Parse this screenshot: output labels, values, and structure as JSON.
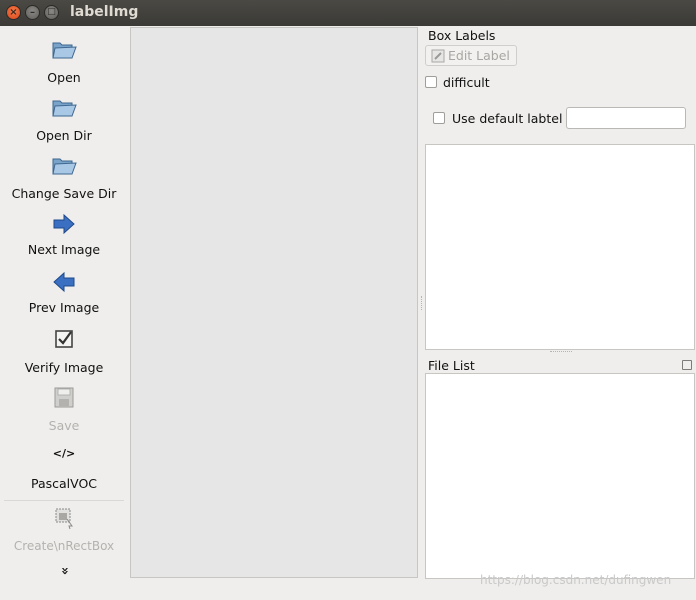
{
  "window": {
    "title": "labelImg",
    "controls": {
      "close": "×",
      "minimize": "–",
      "maximize": "□"
    }
  },
  "toolbar": {
    "items": [
      {
        "label": "Open",
        "icon": "folder-open-icon",
        "enabled": true
      },
      {
        "label": "Open Dir",
        "icon": "folder-open-icon",
        "enabled": true
      },
      {
        "label": "Change Save Dir",
        "icon": "folder-open-icon",
        "enabled": true
      },
      {
        "label": "Next Image",
        "icon": "arrow-right-icon",
        "enabled": true
      },
      {
        "label": "Prev Image",
        "icon": "arrow-left-icon",
        "enabled": true
      },
      {
        "label": "Verify Image",
        "icon": "checkbox-checked-icon",
        "enabled": true
      },
      {
        "label": "Save",
        "icon": "floppy-disk-icon",
        "enabled": false
      },
      {
        "label": "PascalVOC",
        "icon": "code-tag-icon",
        "enabled": true,
        "glyph": "</>"
      },
      {
        "label": "Create\\nRectBox",
        "icon": "rectangle-draw-icon",
        "enabled": false
      }
    ],
    "more_glyph": "»"
  },
  "box_labels": {
    "title": "Box Labels",
    "edit_label_button": "Edit Label",
    "difficult_label": "difficult",
    "difficult_checked": false,
    "use_default_label": "Use default labtel",
    "use_default_checked": false,
    "default_label_value": ""
  },
  "file_list": {
    "title": "File List"
  },
  "watermark": "https://blog.csdn.net/dufingwen"
}
